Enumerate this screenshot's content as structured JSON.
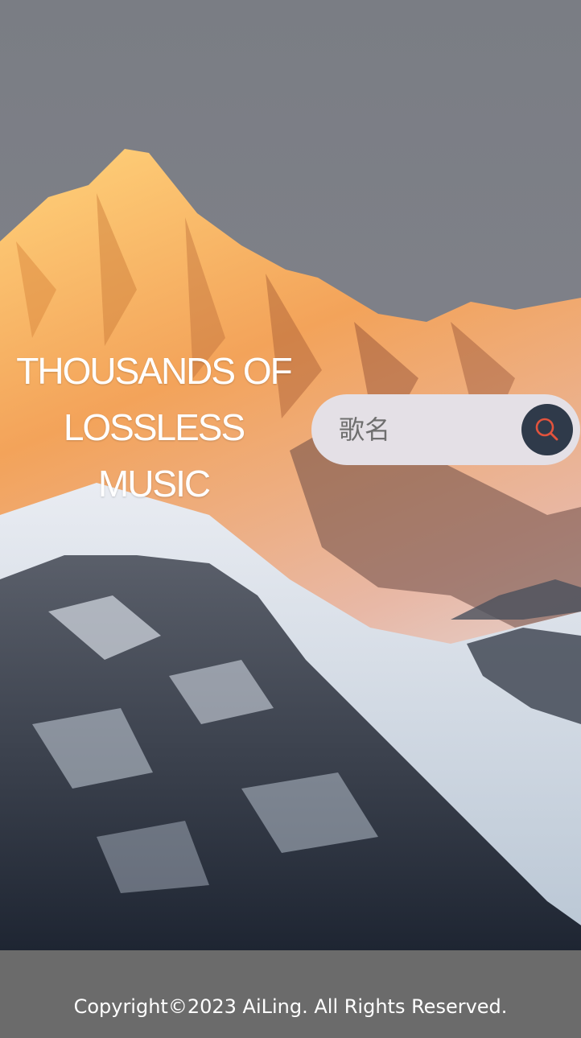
{
  "hero": {
    "tagline_lines": [
      "THOUSANDS OF",
      "LOSSLESS",
      "MUSIC"
    ]
  },
  "search": {
    "placeholder": "歌名",
    "icon": "search-icon"
  },
  "footer": {
    "copyright": "Copyright©2023 AiLing. All Rights Reserved."
  },
  "colors": {
    "sky": "#7b7f86",
    "peak_glow": "#f3b45a",
    "search_bg": "#e4e0e6",
    "search_button": "#2f3a4a",
    "search_icon": "#e2533d",
    "footer_bg": "#6b6b6b",
    "text": "#ffffff"
  }
}
